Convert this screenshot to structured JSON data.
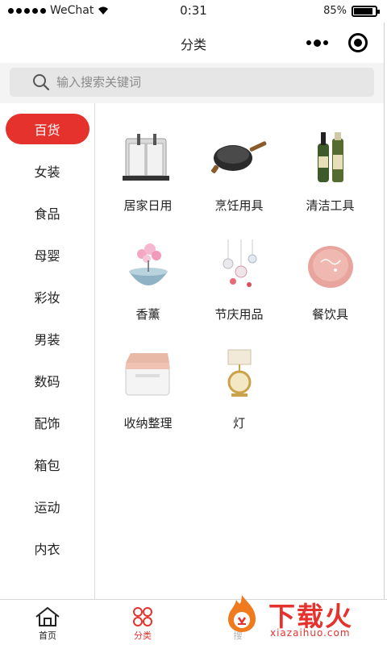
{
  "status": {
    "carrier": "WeChat",
    "time": "0:31",
    "battery": "85%"
  },
  "nav": {
    "title": "分类"
  },
  "search": {
    "placeholder": "输入搜索关键词"
  },
  "sidebar": {
    "items": [
      {
        "label": "百货",
        "active": true
      },
      {
        "label": "女装"
      },
      {
        "label": "食品"
      },
      {
        "label": "母婴"
      },
      {
        "label": "彩妆"
      },
      {
        "label": "男装"
      },
      {
        "label": "数码"
      },
      {
        "label": "配饰"
      },
      {
        "label": "箱包"
      },
      {
        "label": "运动"
      },
      {
        "label": "内衣"
      }
    ]
  },
  "grid": {
    "items": [
      {
        "label": "居家日用",
        "icon": "knife-block-icon"
      },
      {
        "label": "烹饪用具",
        "icon": "wok-pan-icon"
      },
      {
        "label": "清洁工具",
        "icon": "bottles-icon"
      },
      {
        "label": "香薰",
        "icon": "aroma-diffuser-icon"
      },
      {
        "label": "节庆用品",
        "icon": "ornaments-icon"
      },
      {
        "label": "餐饮具",
        "icon": "plate-icon"
      },
      {
        "label": "收纳整理",
        "icon": "storage-box-icon"
      },
      {
        "label": "灯",
        "icon": "lamp-icon"
      }
    ]
  },
  "tabbar": {
    "home_label": "首页",
    "category_label": "分类",
    "third_label": "搜"
  },
  "watermark": {
    "title": "下载火",
    "sub": "xiazaihuo.com"
  },
  "colors": {
    "accent": "#e5322d",
    "search_bg": "#e6e6e6"
  }
}
